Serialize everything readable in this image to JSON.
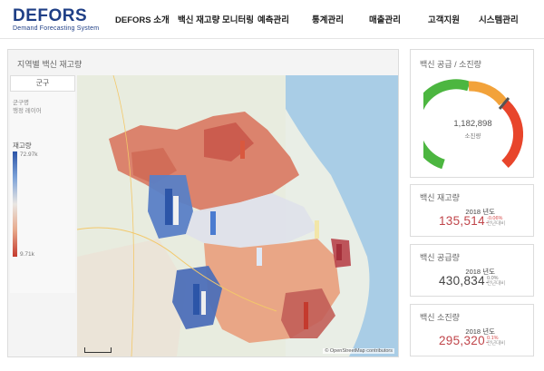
{
  "brand": {
    "title": "DEFORS",
    "subtitle": "Demand Forecasting System"
  },
  "nav": [
    "DEFORS 소개",
    "백신 재고량 모니터링",
    "예측관리",
    "통계관리",
    "매출관리",
    "고객지원",
    "시스템관리"
  ],
  "map_panel": {
    "title": "지역별 백신 재고량",
    "tab_label": "군구",
    "layer_line1": "군구명",
    "layer_line2": "행정 레이어",
    "legend_title": "재고량",
    "legend_max": "72.97k",
    "legend_min": "9.71k",
    "attribution": "© OpenStreetMap contributors",
    "colors": {
      "high": "#2c55a8",
      "mid": "#e9e6e2",
      "low": "#c43a2e"
    }
  },
  "gauge": {
    "title": "백신 공급 / 소진량",
    "value": "1,182,898",
    "label": "소진량",
    "colors": {
      "green": "#4cb640",
      "orange": "#f2a23a",
      "red": "#e8452b"
    }
  },
  "kpis": [
    {
      "title": "백신 재고량",
      "year": "2018 년도",
      "value": "135,514",
      "arrow": "-",
      "change": "-0.06%",
      "change_label": "전년대비",
      "value_color": "#c0454a",
      "change_color": "#d64a4a"
    },
    {
      "title": "백신 공급량",
      "year": "2018 년도",
      "value": "430,834",
      "arrow": "-",
      "change": "0.0%",
      "change_label": "전년대비",
      "value_color": "#444444",
      "change_color": "#777777"
    },
    {
      "title": "백신 소진량",
      "year": "2018 년도",
      "value": "295,320",
      "arrow": "-",
      "change": "0.1%",
      "change_label": "전년대비",
      "value_color": "#c0454a",
      "change_color": "#d64a4a"
    }
  ]
}
